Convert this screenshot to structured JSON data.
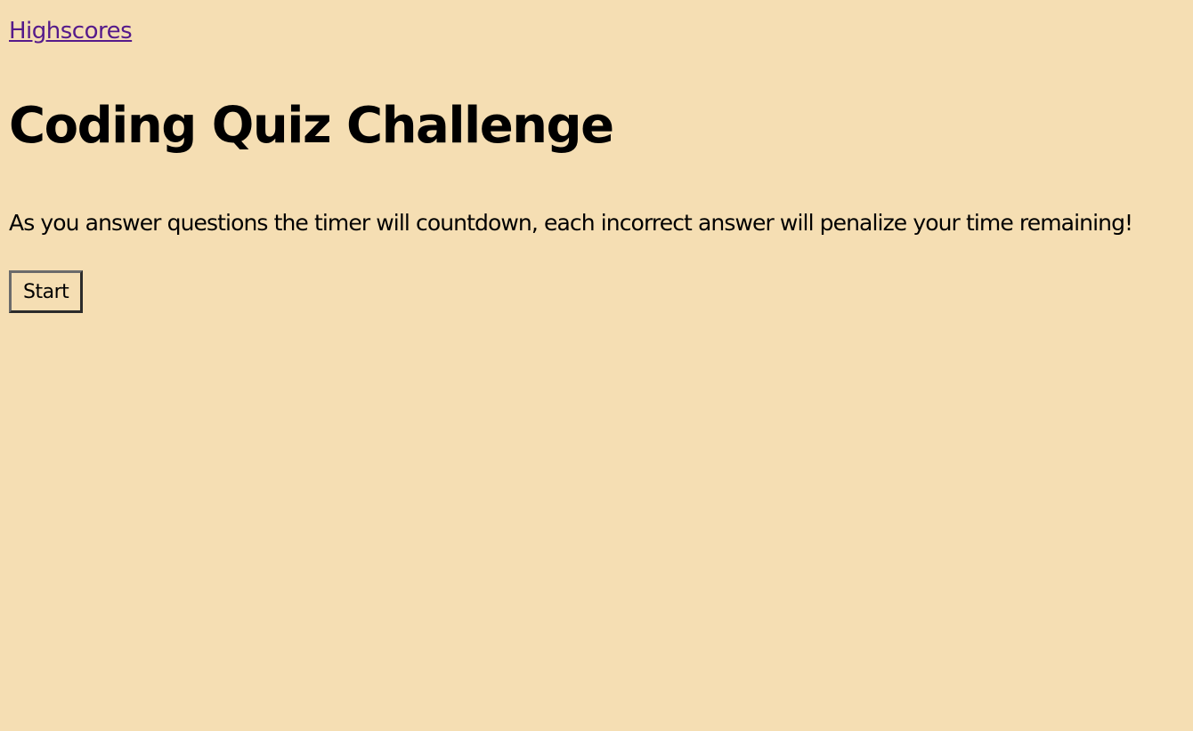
{
  "nav": {
    "highscores_label": "Highscores"
  },
  "main": {
    "title": "Coding Quiz Challenge",
    "instructions": "As you answer questions the timer will countdown, each incorrect answer will penalize your time remaining!",
    "start_label": "Start"
  },
  "colors": {
    "background": "#f5deb3",
    "link": "#551a8b",
    "text": "#000000"
  }
}
